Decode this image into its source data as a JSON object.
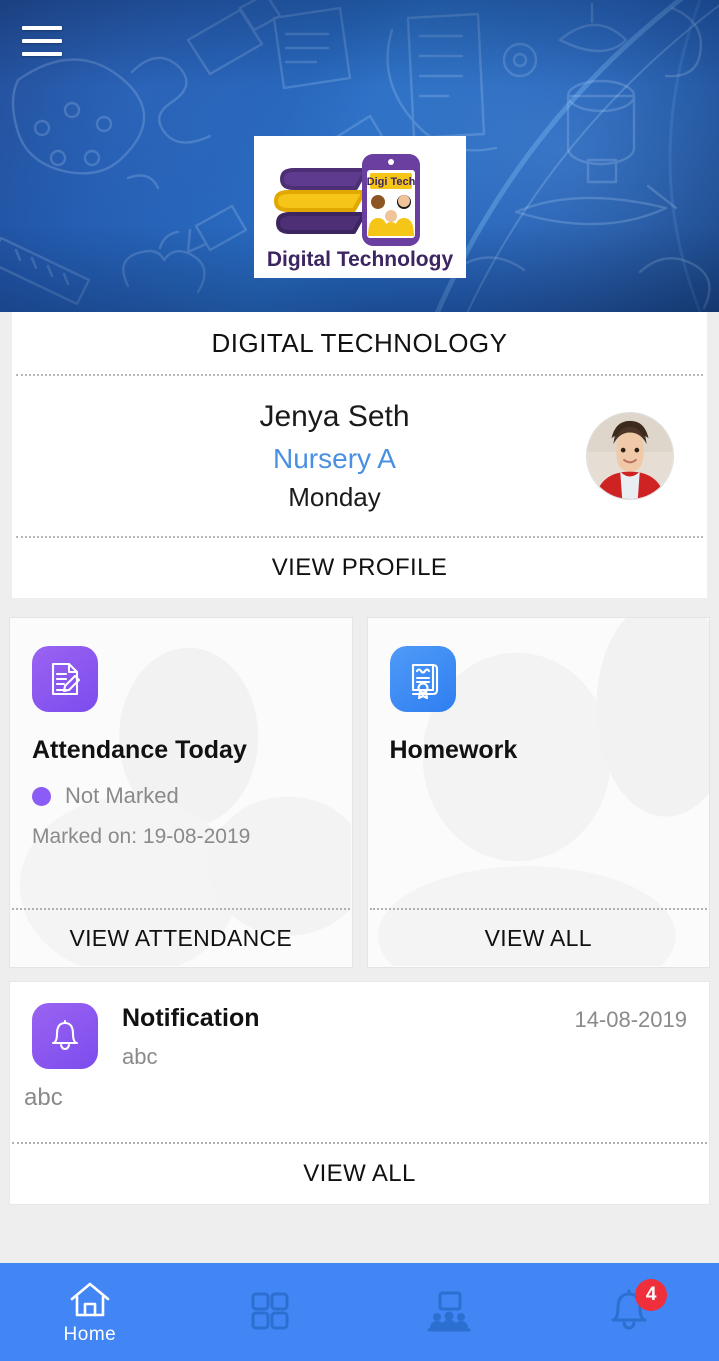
{
  "header": {
    "menu_icon": "hamburger-menu-icon",
    "logo": {
      "brand_top": "Digi Tech",
      "brand_bottom": "Digital Technology"
    }
  },
  "profile": {
    "school_name": "DIGITAL TECHNOLOGY",
    "student_name": "Jenya Seth",
    "student_class": "Nursery A",
    "day": "Monday",
    "avatar_icon": "student-avatar",
    "action_label": "VIEW PROFILE",
    "class_color": "#4a90e2"
  },
  "tiles": [
    {
      "title": "Attendance Today",
      "icon": "document-pencil-icon",
      "icon_color": "#7c4ced",
      "status": "Not Marked",
      "status_dot_color": "#8b5cf6",
      "marked_on": "Marked on: 19-08-2019",
      "action_label": "VIEW ATTENDANCE"
    },
    {
      "title": "Homework",
      "icon": "certificate-icon",
      "icon_color": "#2f7ef0",
      "action_label": "VIEW ALL"
    }
  ],
  "notification": {
    "icon": "bell-icon",
    "icon_color": "#7c4ced",
    "title": "Notification",
    "subtitle": "abc",
    "date": "14-08-2019",
    "body": "abc",
    "action_label": "VIEW ALL"
  },
  "bottom_nav": {
    "background": "#4285f4",
    "items": [
      {
        "icon": "home-icon",
        "label": "Home",
        "active": true
      },
      {
        "icon": "grid-apps-icon",
        "label": "",
        "active": false
      },
      {
        "icon": "classroom-people-icon",
        "label": "",
        "active": false
      },
      {
        "icon": "bell-icon",
        "label": "",
        "active": false,
        "badge": "4",
        "badge_color": "#ef2f3c"
      }
    ]
  }
}
